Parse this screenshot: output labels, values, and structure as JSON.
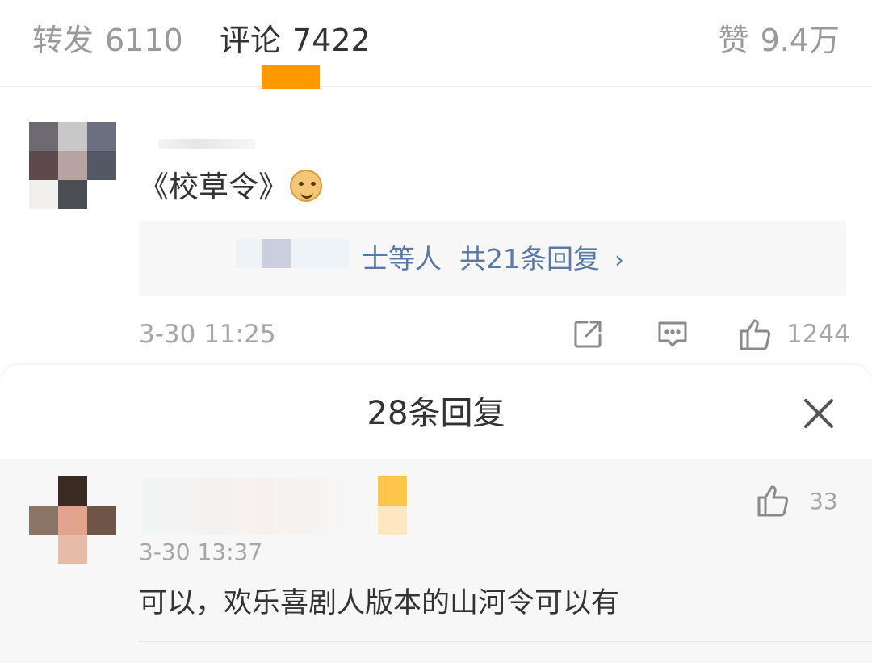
{
  "tabs": {
    "repost": {
      "label": "转发",
      "count": "6110"
    },
    "comment": {
      "label": "评论",
      "count": "7422"
    },
    "like": {
      "label": "赞",
      "count": "9.4万"
    },
    "indicator_color": "#ff9900"
  },
  "comment": {
    "avatar": "mosaic-avatar",
    "text": "《校草令》",
    "emoji": "doge-emoji",
    "replies_summary": {
      "names_suffix": "士等人",
      "total": "共21条回复",
      "chevron": "chevron-right-icon"
    },
    "time": "3-30 11:25",
    "actions": {
      "share_icon": "share-icon",
      "comment_icon": "comment-icon",
      "like_icon": "thumbs-up-icon",
      "like_count": "1244"
    }
  },
  "reply_sheet": {
    "title": "28条回复",
    "close_icon": "close-icon",
    "replies": [
      {
        "avatar": "mosaic-avatar",
        "time": "3-30 13:37",
        "like_icon": "thumbs-up-icon",
        "like_count": "33",
        "text": "可以，欢乐喜剧人版本的山河令可以有"
      }
    ]
  }
}
